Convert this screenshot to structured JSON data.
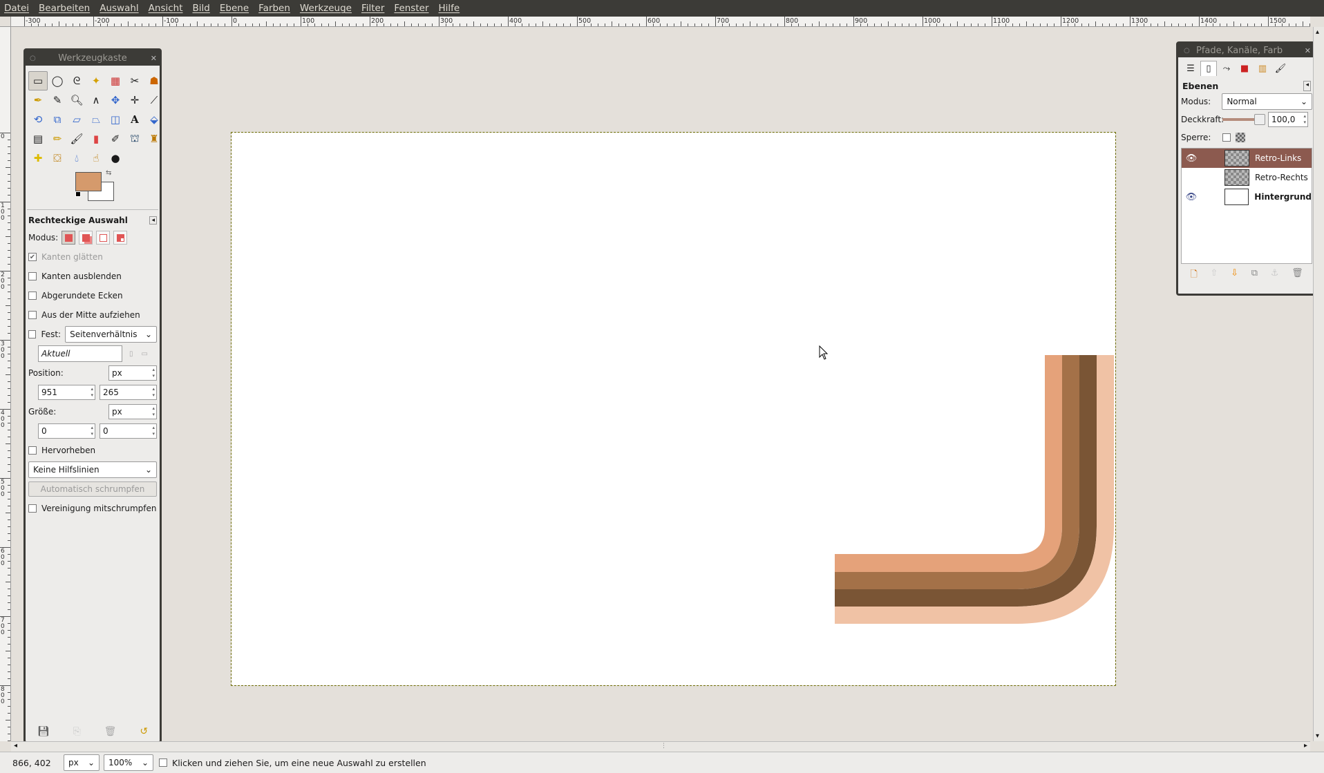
{
  "menu": [
    "Datei",
    "Bearbeiten",
    "Auswahl",
    "Ansicht",
    "Bild",
    "Ebene",
    "Farben",
    "Werkzeuge",
    "Filter",
    "Fenster",
    "Hilfe"
  ],
  "ruler_labels": [
    "-300",
    "-200",
    "-100",
    "0",
    "100",
    "200",
    "300",
    "400",
    "500",
    "600",
    "700",
    "800",
    "900",
    "1000",
    "1100",
    "1200",
    "1300",
    "1400",
    "1500"
  ],
  "vruler_labels": [
    "0",
    "100",
    "200",
    "300",
    "400",
    "500",
    "600",
    "700",
    "800"
  ],
  "toolbox": {
    "title": "Werkzeugkaste",
    "tool_options_title": "Rechteckige Auswahl",
    "mode_label": "Modus:",
    "antialias_label": "Kanten glätten",
    "feather_label": "Kanten ausblenden",
    "rounded_label": "Abgerundete Ecken",
    "expand_center_label": "Aus der Mitte aufziehen",
    "fixed_label": "Fest:",
    "fixed_option": "Seitenverhältnis",
    "fixed_value_placeholder": "Aktuell",
    "position_label": "Position:",
    "position_unit": "px",
    "position_x": "951",
    "position_y": "265",
    "size_label": "Größe:",
    "size_unit": "px",
    "size_w": "0",
    "size_h": "0",
    "highlight_label": "Hervorheben",
    "guides_option": "Keine Hilfslinien",
    "auto_shrink_label": "Automatisch schrumpfen",
    "shrink_merged_label": "Vereinigung mitschrumpfen",
    "fg_color": "#d59a6c",
    "bg_color": "#ffffff"
  },
  "dock": {
    "title": "Pfade, Kanäle, Farb",
    "layers_title": "Ebenen",
    "mode_label": "Modus:",
    "mode_value": "Normal",
    "opacity_label": "Deckkraft:",
    "opacity_value": "100,0",
    "lock_label": "Sperre:",
    "layers": [
      {
        "name": "Retro-Links",
        "visible": true,
        "selected": true
      },
      {
        "name": "Retro-Rechts",
        "visible": false,
        "selected": false
      },
      {
        "name": "Hintergrund",
        "visible": true,
        "selected": false
      }
    ]
  },
  "status": {
    "coords": "866, 402",
    "unit": "px",
    "zoom": "100%",
    "message": "Klicken und ziehen Sie, um eine neue Auswahl zu erstellen"
  },
  "stripe_colors": [
    "#e5a27a",
    "#a47148",
    "#7a5535",
    "#f0c2a5"
  ]
}
